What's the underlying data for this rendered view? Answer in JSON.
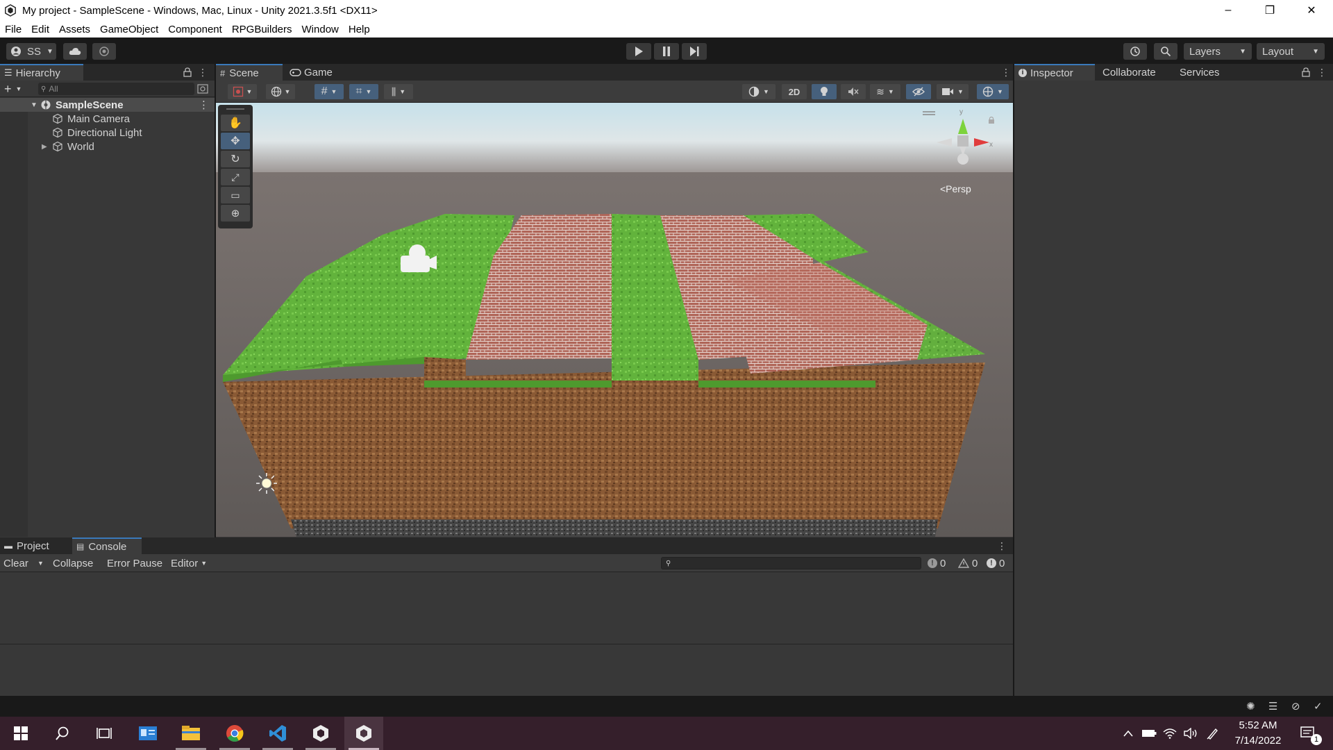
{
  "window": {
    "title": "My project - SampleScene - Windows, Mac, Linux - Unity 2021.3.5f1 <DX11>",
    "minimize": "–",
    "restore": "❐",
    "close": "✕"
  },
  "menu": [
    "File",
    "Edit",
    "Assets",
    "GameObject",
    "Component",
    "RPGBuilders",
    "Window",
    "Help"
  ],
  "toolbar": {
    "account": "SS",
    "layers": "Layers",
    "layout": "Layout"
  },
  "hierarchy": {
    "tab_label": "Hierarchy",
    "search_placeholder": "All",
    "scene_name": "SampleScene",
    "items": [
      "Main Camera",
      "Directional Light",
      "World"
    ]
  },
  "scene": {
    "tabs": [
      "Scene",
      "Game"
    ],
    "mode_2d": "2D",
    "persp_label": "<Persp",
    "gizmo_y": "y",
    "gizmo_x": "x"
  },
  "console": {
    "tabs": [
      "Project",
      "Console"
    ],
    "clear": "Clear",
    "collapse": "Collapse",
    "error_pause": "Error Pause",
    "editor": "Editor",
    "log_count": "0",
    "warn_count": "0",
    "error_count": "0"
  },
  "inspector": {
    "tabs": [
      "Inspector",
      "Collaborate",
      "Services"
    ]
  },
  "taskbar": {
    "time": "5:52 AM",
    "date": "7/14/2022",
    "notif_count": "1"
  },
  "colors": {
    "accent": "#3a79bb",
    "grass": "#5fae3a",
    "brick": "#a85a4e",
    "dirt": "#8a5a35",
    "sky_top": "#c6e1ea",
    "horizon": "#7a716e"
  }
}
